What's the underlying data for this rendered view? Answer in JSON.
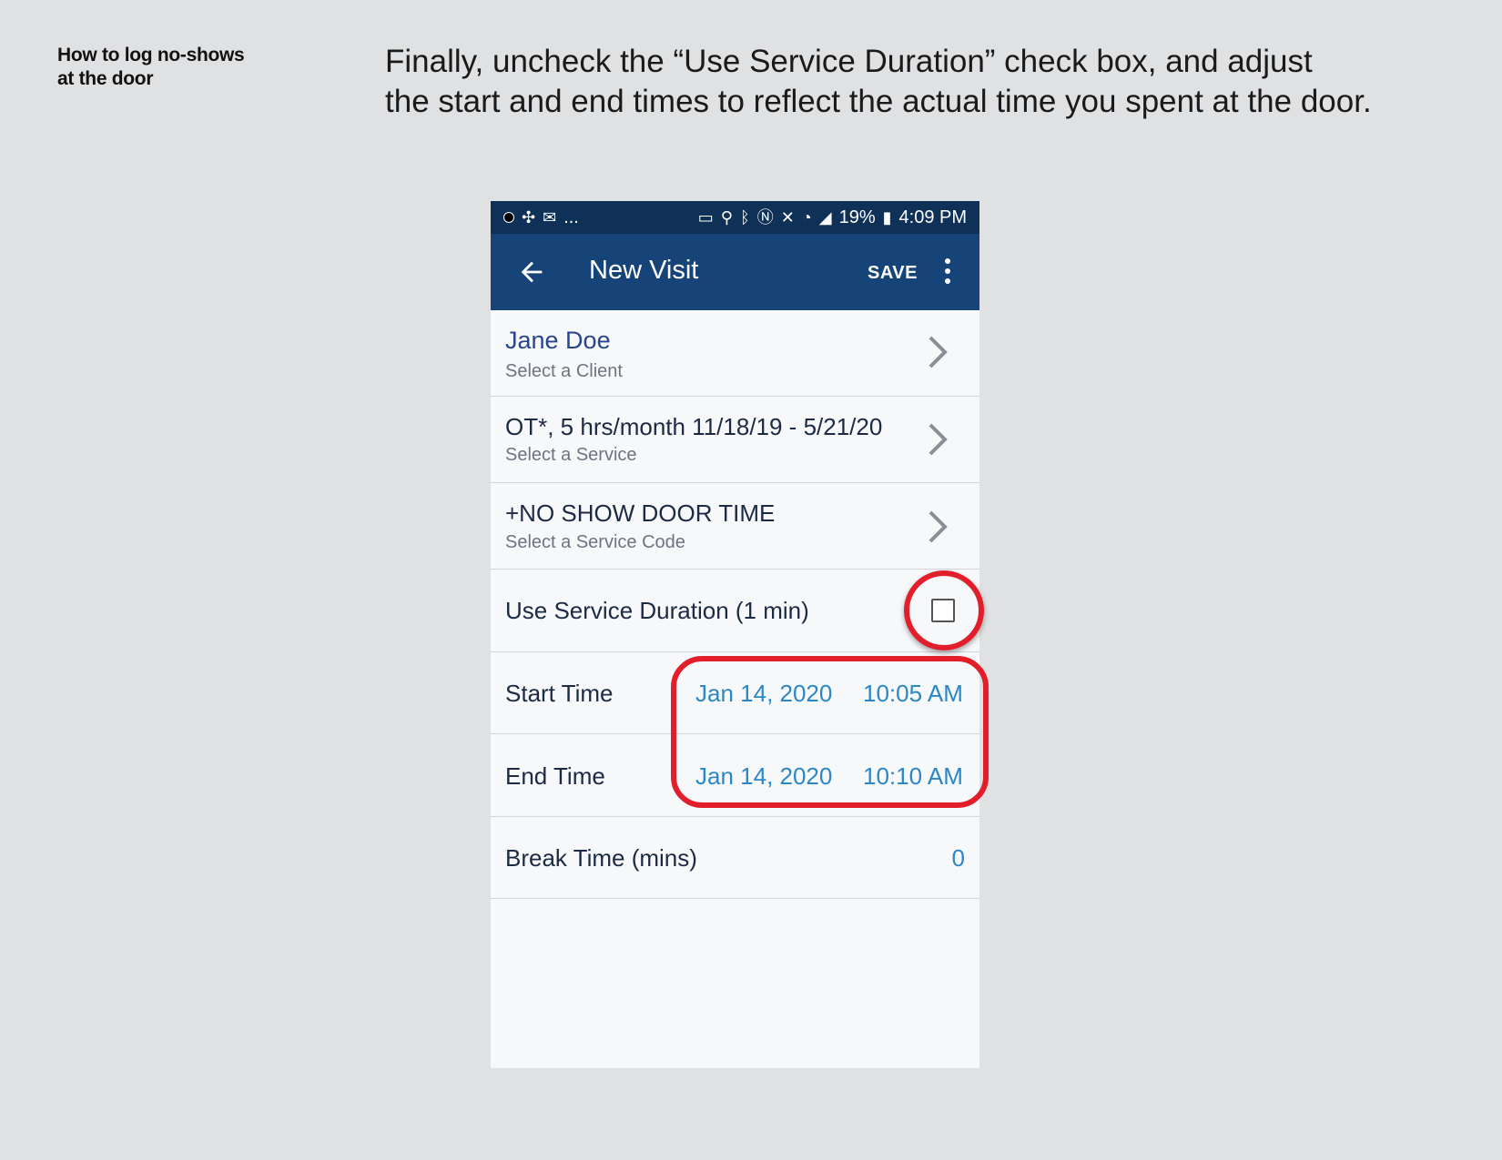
{
  "slide": {
    "side_title_line1": "How to log no-shows",
    "side_title_line2": "at the door",
    "instruction_line1": "Finally, uncheck the “Use Service Duration” check box, and adjust",
    "instruction_line2": "the start and end times to reflect the actual time you spent at the door."
  },
  "status_bar": {
    "left_text": "...",
    "battery": "19%",
    "time": "4:09 PM",
    "icons": [
      "notification-dot-icon",
      "sync-icon",
      "mail-icon",
      "cast-icon",
      "location-icon",
      "bluetooth-icon",
      "nfc-icon",
      "mute-icon",
      "wifi-icon",
      "signal-icon",
      "battery-icon"
    ]
  },
  "app_bar": {
    "title": "New Visit",
    "save_label": "SAVE",
    "back_icon": "arrow-back-icon",
    "menu_icon": "more-vert-icon"
  },
  "client": {
    "name": "Jane Doe",
    "hint": "Select a Client"
  },
  "service": {
    "name": "OT*, 5 hrs/month 11/18/19 - 5/21/20",
    "hint": "Select a Service"
  },
  "service_code": {
    "name": "+NO SHOW DOOR TIME",
    "hint": "Select a Service Code"
  },
  "use_duration": {
    "label": "Use Service Duration (1 min)",
    "checked": false
  },
  "start_time": {
    "label": "Start Time",
    "date": "Jan 14, 2020",
    "time": "10:05 AM"
  },
  "end_time": {
    "label": "End Time",
    "date": "Jan 14, 2020",
    "time": "10:10 AM"
  },
  "break_time": {
    "label": "Break Time (mins)",
    "value": "0"
  },
  "colors": {
    "status_bar": "#0f3057",
    "app_bar": "#164478",
    "link_value": "#2b87c7",
    "highlight_ring": "#e21e2a"
  }
}
